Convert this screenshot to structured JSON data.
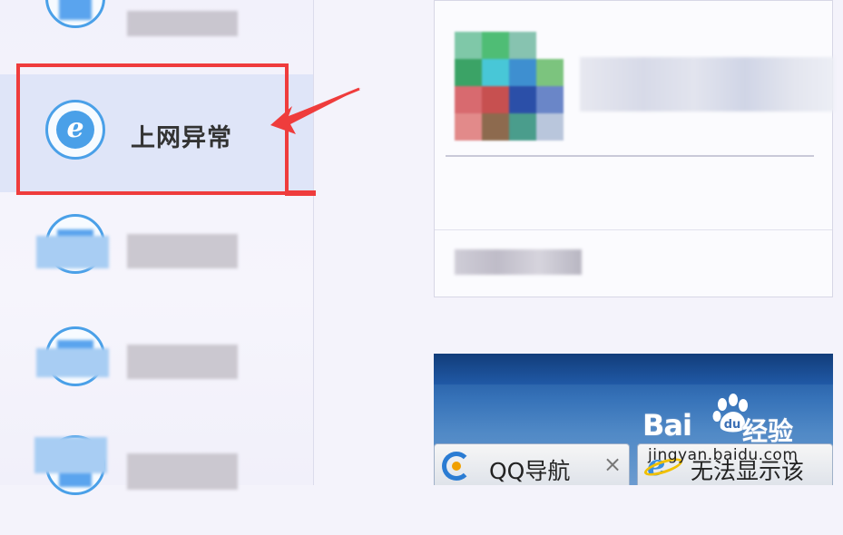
{
  "sidebar": {
    "items": [
      {
        "id": "item-top",
        "label": "",
        "blurred": true
      },
      {
        "id": "item-network",
        "label": "上网异常",
        "icon": "ie-icon",
        "active": true
      },
      {
        "id": "item-3",
        "label": "",
        "blurred": true
      },
      {
        "id": "item-4",
        "label": "",
        "blurred": true
      },
      {
        "id": "item-5",
        "label": "",
        "blurred": true
      }
    ]
  },
  "browser": {
    "tabs": [
      {
        "label": "QQ导航",
        "close": "×",
        "icon": "qq-nav-icon"
      },
      {
        "label": "无法显示该",
        "icon": "ie-icon"
      }
    ]
  },
  "watermark": {
    "brand_a": "Bai",
    "brand_b": "经验",
    "url": "jingyan.baidu.com"
  },
  "ie_glyph": "e",
  "colors": {
    "highlight": "#ef3c3c",
    "active_bg": "#dfe5f8",
    "icon_blue": "#4aa0e8"
  }
}
